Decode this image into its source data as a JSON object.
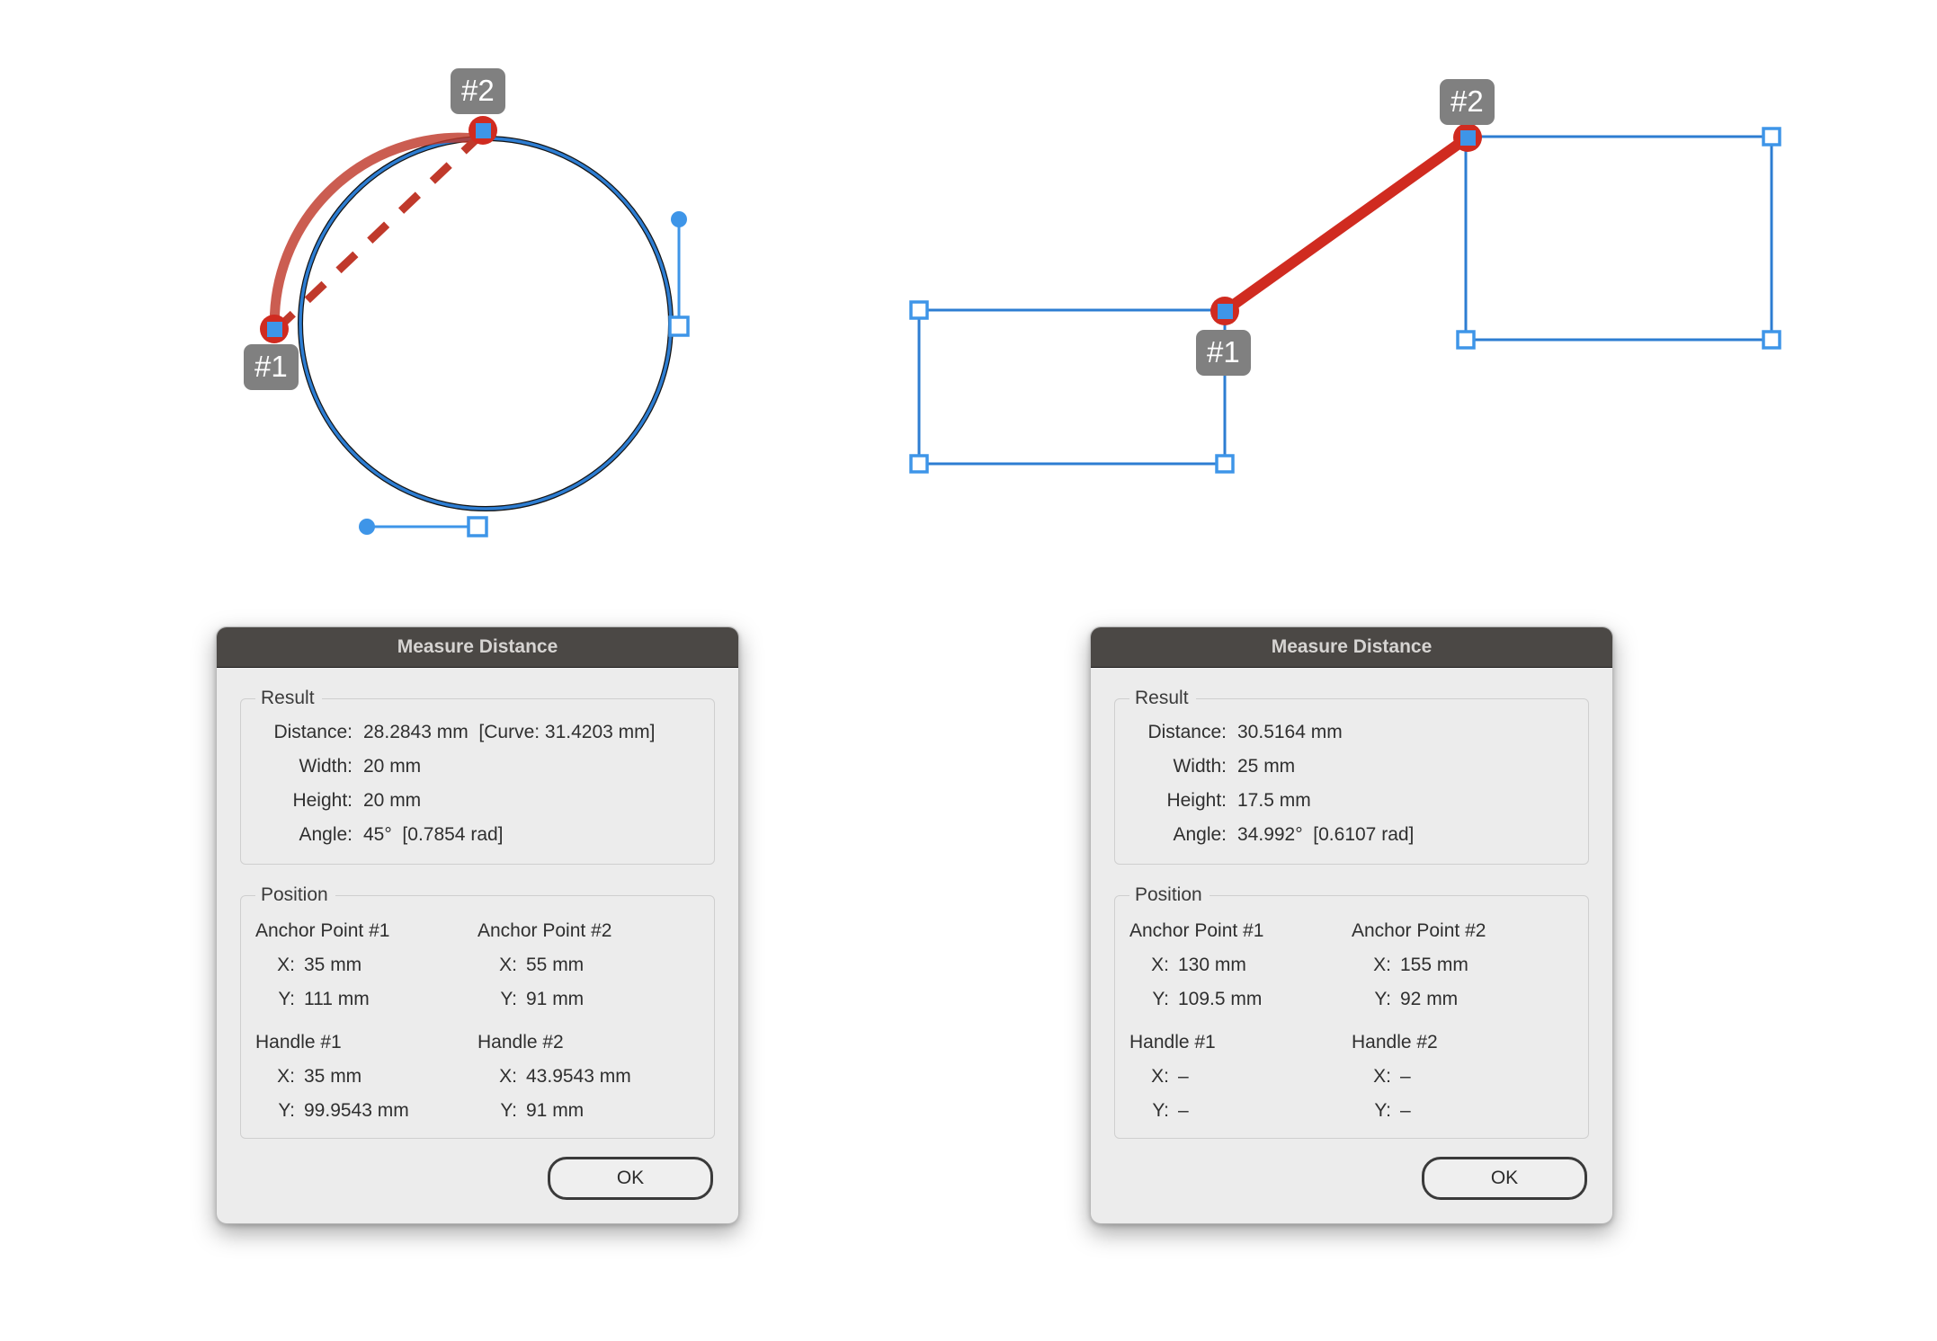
{
  "canvas": {
    "badges": [
      {
        "id": "circle-p2",
        "label": "#2"
      },
      {
        "id": "circle-p1",
        "label": "#1"
      },
      {
        "id": "rect-p2",
        "label": "#2"
      },
      {
        "id": "rect-p1",
        "label": "#1"
      }
    ],
    "colors": {
      "path_blue": "#2d7dd2",
      "path_outline": "#111111",
      "measure_red": "#d02b20",
      "arc_highlight": "#c0392b",
      "handle_blue": "#3e95e8",
      "badge_gray": "#808080"
    }
  },
  "dialogs": [
    {
      "id": "measure-distance-left",
      "title": "Measure Distance",
      "result": {
        "legend": "Result",
        "rows": [
          {
            "label": "Distance:",
            "value": "28.2843 mm  [Curve: 31.4203 mm]"
          },
          {
            "label": "Width:",
            "value": "20 mm"
          },
          {
            "label": "Height:",
            "value": "20 mm"
          },
          {
            "label": "Angle:",
            "value": "45°  [0.7854 rad]"
          }
        ]
      },
      "position": {
        "legend": "Position",
        "anchor1": {
          "heading": "Anchor Point #1",
          "x_key": "X:",
          "x_value": "35 mm",
          "y_key": "Y:",
          "y_value": "111 mm"
        },
        "anchor2": {
          "heading": "Anchor Point #2",
          "x_key": "X:",
          "x_value": "55 mm",
          "y_key": "Y:",
          "y_value": "91 mm"
        },
        "handle1": {
          "heading": "Handle #1",
          "x_key": "X:",
          "x_value": "35 mm",
          "y_key": "Y:",
          "y_value": "99.9543 mm"
        },
        "handle2": {
          "heading": "Handle #2",
          "x_key": "X:",
          "x_value": "43.9543 mm",
          "y_key": "Y:",
          "y_value": "91 mm"
        }
      },
      "ok_label": "OK"
    },
    {
      "id": "measure-distance-right",
      "title": "Measure Distance",
      "result": {
        "legend": "Result",
        "rows": [
          {
            "label": "Distance:",
            "value": "30.5164 mm"
          },
          {
            "label": "Width:",
            "value": "25 mm"
          },
          {
            "label": "Height:",
            "value": "17.5 mm"
          },
          {
            "label": "Angle:",
            "value": "34.992°  [0.6107 rad]"
          }
        ]
      },
      "position": {
        "legend": "Position",
        "anchor1": {
          "heading": "Anchor Point #1",
          "x_key": "X:",
          "x_value": "130 mm",
          "y_key": "Y:",
          "y_value": "109.5 mm"
        },
        "anchor2": {
          "heading": "Anchor Point #2",
          "x_key": "X:",
          "x_value": "155 mm",
          "y_key": "Y:",
          "y_value": "92 mm"
        },
        "handle1": {
          "heading": "Handle #1",
          "x_key": "X:",
          "x_value": "–",
          "y_key": "Y:",
          "y_value": "–"
        },
        "handle2": {
          "heading": "Handle #2",
          "x_key": "X:",
          "x_value": "–",
          "y_key": "Y:",
          "y_value": "–"
        }
      },
      "ok_label": "OK"
    }
  ]
}
